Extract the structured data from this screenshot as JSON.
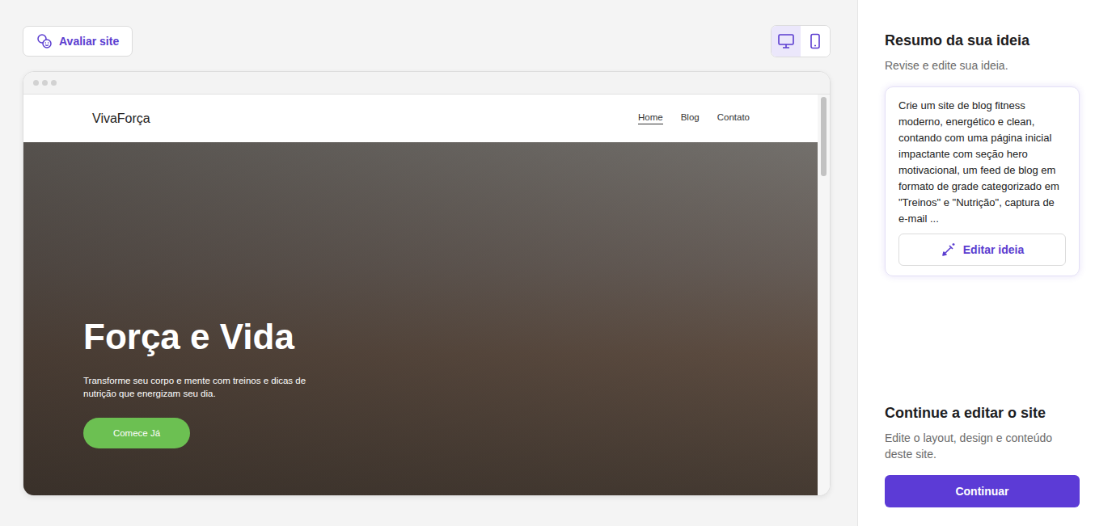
{
  "toolbar": {
    "rate_button": "Avaliar site",
    "devices": [
      {
        "kind": "desktop",
        "selected": true
      },
      {
        "kind": "mobile",
        "selected": false
      }
    ]
  },
  "preview": {
    "logo": "VivaForça",
    "nav": [
      {
        "label": "Home",
        "selected": true
      },
      {
        "label": "Blog",
        "selected": false
      },
      {
        "label": "Contato",
        "selected": false
      }
    ],
    "hero": {
      "title": "Força e Vida",
      "subtitle": "Transforme seu corpo e mente com treinos e dicas de nutrição que energizam seu dia.",
      "button": "Comece Já"
    },
    "scroll_level": 0.2
  },
  "sidebar": {
    "summary": {
      "title": "Resumo da sua ideia",
      "subtitle": "Revise e edite sua ideia.",
      "idea": "Crie um site de blog fitness moderno, energético e clean, contando com uma página inicial impactante com seção hero motivacional, um feed de blog em formato de grade categorizado em \"Treinos\" e \"Nutrição\", captura de e-mail ...",
      "edit_button": "Editar ideia"
    },
    "continue": {
      "title": "Continue a editar o site",
      "description": "Edite o layout, design e conteúdo deste site.",
      "button": "Continuar"
    }
  }
}
